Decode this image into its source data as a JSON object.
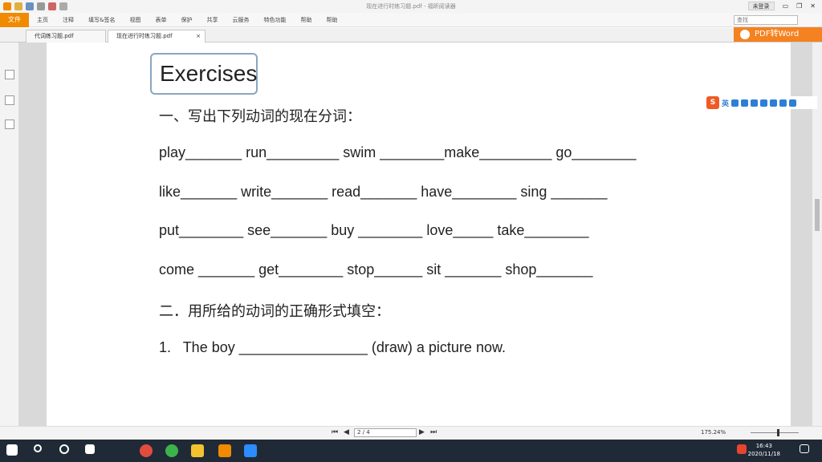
{
  "window": {
    "title": "现在进行时练习题.pdf - 福昕阅读器",
    "login": "未登录"
  },
  "ribbon": {
    "file": "文件",
    "menus": [
      "主页",
      "注释",
      "填写&签名",
      "视图",
      "表单",
      "保护",
      "共享",
      "云服务",
      "特色功能",
      "帮助",
      "帮助"
    ],
    "search_placeholder": "查找"
  },
  "tabs": [
    {
      "label": "代词练习题.pdf"
    },
    {
      "label": "现在进行时练习题.pdf",
      "close": "×"
    }
  ],
  "promo": {
    "label": "PDF转Word"
  },
  "document": {
    "title": "Exercises",
    "section1": "一、写出下列动词的现在分词：",
    "rows": [
      "play_______ run_________ swim ________make_________ go________",
      "like_______ write_______ read_______ have________ sing _______",
      "put________ see_______ buy ________ love_____ take________",
      "come _______ get________ stop______ sit _______ shop_______"
    ],
    "section2": "二．用所给的动词的正确形式填空：",
    "q1": "1.   The boy ________________ (draw) a picture now."
  },
  "ime": {
    "lang": "英"
  },
  "statusbar": {
    "page": "2 / 4",
    "zoom": "175.24%"
  },
  "taskbar": {
    "time": "16:43",
    "date": "2020/11/18"
  }
}
